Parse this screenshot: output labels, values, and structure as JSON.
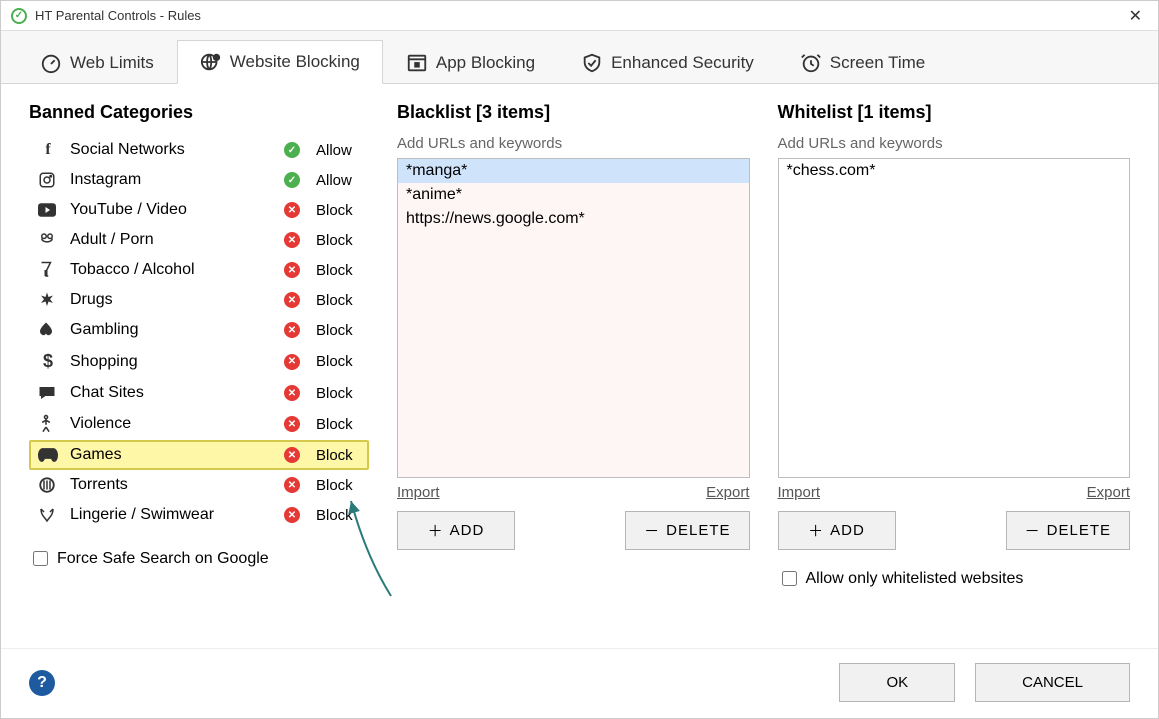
{
  "window": {
    "title": "HT Parental Controls - Rules"
  },
  "tabs": [
    {
      "label": "Web Limits"
    },
    {
      "label": "Website Blocking"
    },
    {
      "label": "App Blocking"
    },
    {
      "label": "Enhanced Security"
    },
    {
      "label": "Screen Time"
    }
  ],
  "banned": {
    "heading": "Banned Categories",
    "items": [
      {
        "icon": "facebook",
        "name": "Social Networks",
        "status": "Allow"
      },
      {
        "icon": "instagram",
        "name": "Instagram",
        "status": "Allow"
      },
      {
        "icon": "youtube",
        "name": "YouTube / Video",
        "status": "Block"
      },
      {
        "icon": "adult",
        "name": "Adult / Porn",
        "status": "Block"
      },
      {
        "icon": "alcohol",
        "name": "Tobacco / Alcohol",
        "status": "Block"
      },
      {
        "icon": "drugs",
        "name": "Drugs",
        "status": "Block"
      },
      {
        "icon": "gambling",
        "name": "Gambling",
        "status": "Block"
      },
      {
        "icon": "shopping",
        "name": "Shopping",
        "status": "Block"
      },
      {
        "icon": "chat",
        "name": "Chat Sites",
        "status": "Block"
      },
      {
        "icon": "violence",
        "name": "Violence",
        "status": "Block"
      },
      {
        "icon": "games",
        "name": "Games",
        "status": "Block"
      },
      {
        "icon": "torrents",
        "name": "Torrents",
        "status": "Block"
      },
      {
        "icon": "lingerie",
        "name": "Lingerie / Swimwear",
        "status": "Block"
      }
    ],
    "selectedIndex": 10,
    "safeSearch": {
      "label": "Force Safe Search on Google",
      "checked": false
    }
  },
  "blacklist": {
    "heading": "Blacklist [3 items]",
    "sub": "Add URLs and keywords",
    "items": [
      "*manga*",
      "*anime*",
      "https://news.google.com*"
    ],
    "selectedIndex": 0,
    "importLabel": "Import",
    "exportLabel": "Export",
    "addLabel": "ADD",
    "deleteLabel": "DELETE"
  },
  "whitelist": {
    "heading": "Whitelist [1 items]",
    "sub": "Add URLs and keywords",
    "items": [
      "*chess.com*"
    ],
    "selectedIndex": -1,
    "importLabel": "Import",
    "exportLabel": "Export",
    "addLabel": "ADD",
    "deleteLabel": "DELETE",
    "onlyWhitelist": {
      "label": "Allow only whitelisted websites",
      "checked": false
    }
  },
  "footer": {
    "ok": "OK",
    "cancel": "CANCEL"
  }
}
